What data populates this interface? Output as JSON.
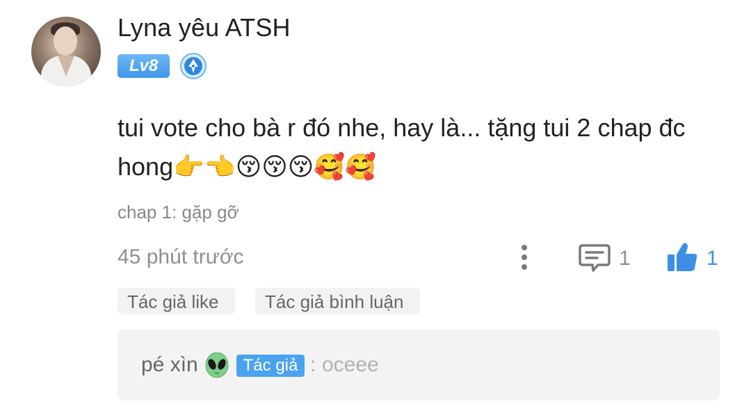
{
  "comment": {
    "username": "Lyna yêu ATSH",
    "level": "Lv8",
    "avatar_icon": "user-avatar",
    "medal_icon": "pen-nib-medal-icon",
    "text": "tui vote cho bà r đó nhe, hay là... tặng tui 2 chap đc hong👉👈😚😚😚🥰🥰",
    "chapter": "chap 1: gặp gỡ",
    "time": "45 phút trước",
    "reply_count": "1",
    "like_count": "1",
    "tags": [
      "Tác giả like",
      "Tác giả bình luận"
    ]
  },
  "reply": {
    "name": "pé xìn",
    "badge": "Tác giả",
    "separator": ":",
    "text": "oceee"
  },
  "colors": {
    "accent": "#3d8fe6",
    "badge": "#4aa3f0",
    "muted_text": "#8f8f8f",
    "reply_bg": "#f3f3f3"
  }
}
